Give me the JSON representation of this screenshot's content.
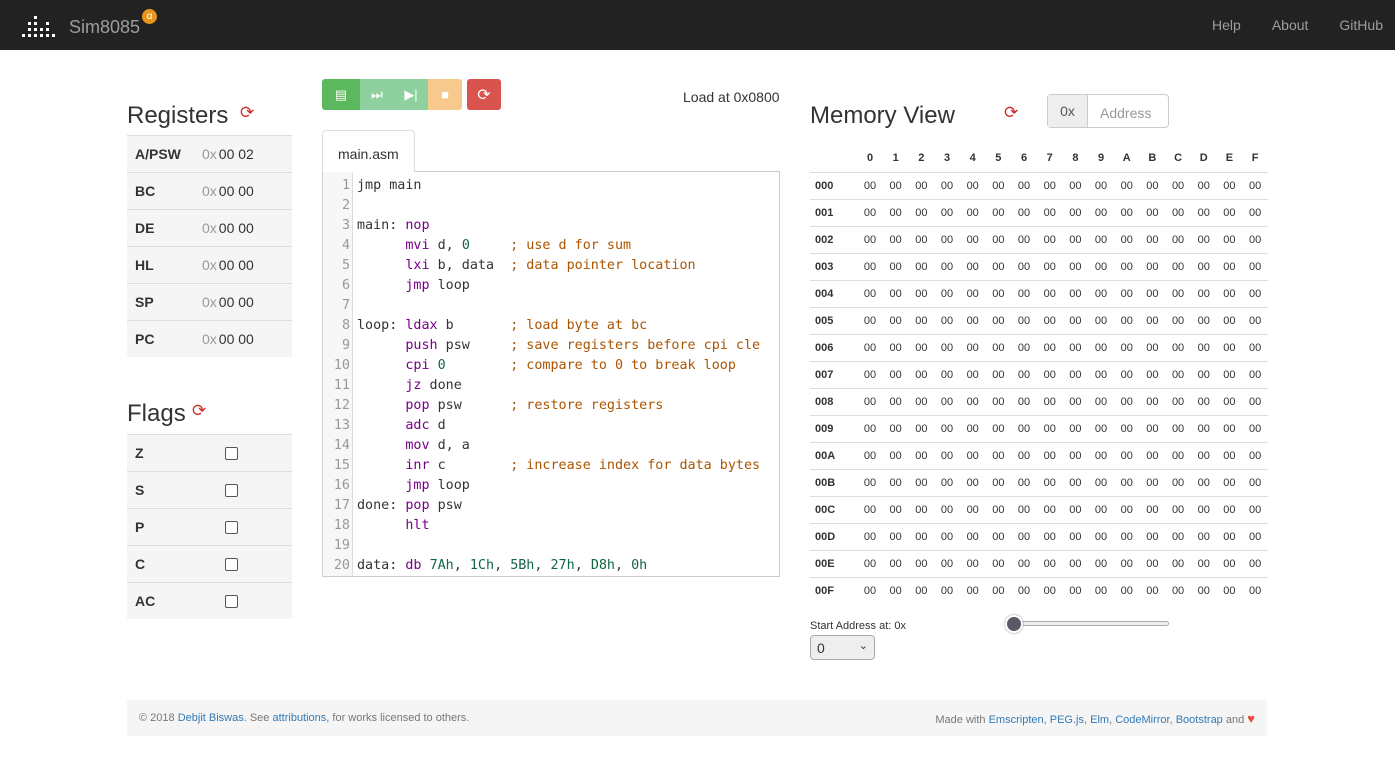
{
  "nav": {
    "brand": "Sim8085",
    "badge": "α",
    "links": [
      "Help",
      "About",
      "GitHub"
    ]
  },
  "registers": {
    "title": "Registers",
    "prefix": "0x",
    "items": [
      {
        "name": "A/PSW",
        "value": "00 02"
      },
      {
        "name": "BC",
        "value": "00 00"
      },
      {
        "name": "DE",
        "value": "00 00"
      },
      {
        "name": "HL",
        "value": "00 00"
      },
      {
        "name": "SP",
        "value": "00 00"
      },
      {
        "name": "PC",
        "value": "00 00"
      }
    ]
  },
  "flags": {
    "title": "Flags",
    "items": [
      {
        "name": "Z",
        "checked": false
      },
      {
        "name": "S",
        "checked": false
      },
      {
        "name": "P",
        "checked": false
      },
      {
        "name": "C",
        "checked": false
      },
      {
        "name": "AC",
        "checked": false
      }
    ]
  },
  "toolbar": {
    "load_at": "Load at 0x0800",
    "buttons": [
      "assemble-and-load",
      "run",
      "step",
      "stop",
      "reset"
    ],
    "colors": {
      "green": "#5cb85c",
      "light_green": "#8fd19e",
      "orange": "#f7c98c",
      "red": "#d9534f"
    }
  },
  "editor": {
    "tab": "main.asm",
    "lines": [
      [
        [
          "",
          "jmp main"
        ]
      ],
      [],
      [
        [
          "",
          "main: "
        ],
        [
          "kw",
          "nop"
        ]
      ],
      [
        [
          "",
          "      "
        ],
        [
          "kw",
          "mvi"
        ],
        [
          "",
          " d, "
        ],
        [
          "num",
          "0"
        ],
        [
          "",
          " "
        ],
        [
          "cm",
          "    ; use d for sum"
        ]
      ],
      [
        [
          "",
          "      "
        ],
        [
          "kw",
          "lxi"
        ],
        [
          "",
          " b, data  "
        ],
        [
          "cm",
          "; data pointer location"
        ]
      ],
      [
        [
          "",
          "      "
        ],
        [
          "kw",
          "jmp"
        ],
        [
          "",
          " loop"
        ]
      ],
      [],
      [
        [
          "",
          "loop: "
        ],
        [
          "kw",
          "ldax"
        ],
        [
          "",
          " b       "
        ],
        [
          "cm",
          "; load byte at bc"
        ]
      ],
      [
        [
          "",
          "      "
        ],
        [
          "kw",
          "push"
        ],
        [
          "",
          " psw     "
        ],
        [
          "cm",
          "; save registers before cpi cle"
        ]
      ],
      [
        [
          "",
          "      "
        ],
        [
          "kw",
          "cpi"
        ],
        [
          "",
          " "
        ],
        [
          "num",
          "0"
        ],
        [
          "",
          "        "
        ],
        [
          "cm",
          "; compare to 0 to break loop"
        ]
      ],
      [
        [
          "",
          "      "
        ],
        [
          "kw",
          "jz"
        ],
        [
          "",
          " done"
        ]
      ],
      [
        [
          "",
          "      "
        ],
        [
          "kw",
          "pop"
        ],
        [
          "",
          " psw      "
        ],
        [
          "cm",
          "; restore registers"
        ]
      ],
      [
        [
          "",
          "      "
        ],
        [
          "kw",
          "adc"
        ],
        [
          "",
          " d"
        ]
      ],
      [
        [
          "",
          "      "
        ],
        [
          "kw",
          "mov"
        ],
        [
          "",
          " d, a"
        ]
      ],
      [
        [
          "",
          "      "
        ],
        [
          "kw",
          "inr"
        ],
        [
          "",
          " c        "
        ],
        [
          "cm",
          "; increase index for data bytes"
        ]
      ],
      [
        [
          "",
          "      "
        ],
        [
          "kw",
          "jmp"
        ],
        [
          "",
          " loop"
        ]
      ],
      [
        [
          "",
          "done: "
        ],
        [
          "kw",
          "pop"
        ],
        [
          "",
          " psw"
        ]
      ],
      [
        [
          "",
          "      "
        ],
        [
          "kw",
          "hlt"
        ]
      ],
      [],
      [
        [
          "",
          "data: "
        ],
        [
          "kw",
          "db"
        ],
        [
          "",
          " "
        ],
        [
          "num",
          "7Ah"
        ],
        [
          "",
          ", "
        ],
        [
          "num",
          "1Ch"
        ],
        [
          "",
          ", "
        ],
        [
          "num",
          "5Bh"
        ],
        [
          "",
          ", "
        ],
        [
          "num",
          "27h"
        ],
        [
          "",
          ", "
        ],
        [
          "num",
          "D8h"
        ],
        [
          "",
          ", "
        ],
        [
          "num",
          "0h"
        ]
      ]
    ]
  },
  "memory": {
    "title": "Memory View",
    "address_prefix": "0x",
    "address_placeholder": "Address",
    "columns": [
      "0",
      "1",
      "2",
      "3",
      "4",
      "5",
      "6",
      "7",
      "8",
      "9",
      "A",
      "B",
      "C",
      "D",
      "E",
      "F"
    ],
    "rows": [
      "000",
      "001",
      "002",
      "003",
      "004",
      "005",
      "006",
      "007",
      "008",
      "009",
      "00A",
      "00B",
      "00C",
      "00D",
      "00E",
      "00F"
    ],
    "cell_value": "00",
    "start_label": "Start Address at: 0x",
    "start_value": "0",
    "slider_value": 0
  },
  "footer": {
    "left_pre": "© 2018 ",
    "author": "Debjit Biswas",
    "left_mid": ". See ",
    "attributions": "attributions",
    "left_post": ", for works licensed to others.",
    "right_pre": "Made with ",
    "tools": [
      "Emscripten",
      "PEG.js",
      "Elm",
      "CodeMirror",
      "Bootstrap"
    ],
    "right_post": " and"
  }
}
